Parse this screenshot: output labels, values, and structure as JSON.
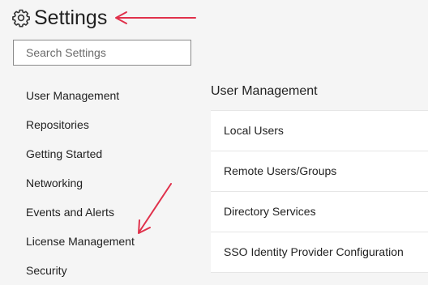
{
  "header": {
    "title": "Settings",
    "icon": "gear-icon"
  },
  "search": {
    "placeholder": "Search Settings"
  },
  "sidebar": {
    "items": [
      {
        "label": "User Management"
      },
      {
        "label": "Repositories"
      },
      {
        "label": "Getting Started"
      },
      {
        "label": "Networking"
      },
      {
        "label": "Events and Alerts"
      },
      {
        "label": "License Management"
      },
      {
        "label": "Security"
      }
    ]
  },
  "panel": {
    "title": "User Management",
    "items": [
      {
        "label": "Local Users"
      },
      {
        "label": "Remote Users/Groups"
      },
      {
        "label": "Directory Services"
      },
      {
        "label": "SSO Identity Provider Configuration"
      }
    ]
  },
  "annotations": {
    "arrow_color": "#e0314b"
  }
}
